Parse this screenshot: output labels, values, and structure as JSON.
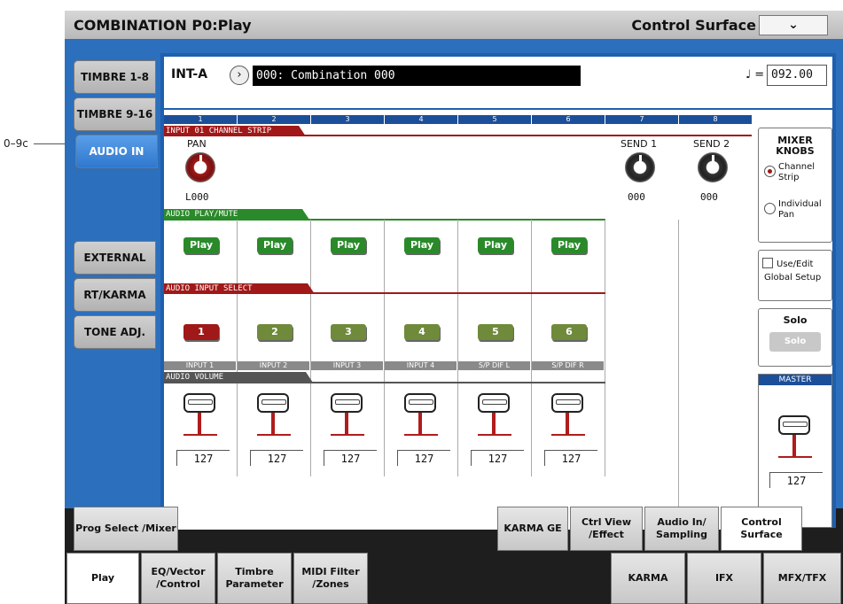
{
  "external_label": "0–9c",
  "title_left": "COMBINATION P0:Play",
  "title_right": "Control Surface",
  "side_tabs": [
    "TIMBRE 1-8",
    "TIMBRE 9-16",
    "AUDIO IN",
    "EXTERNAL",
    "RT/KARMA",
    "TONE ADJ."
  ],
  "bank": "INT-A",
  "program_name": "000: Combination 000",
  "tempo_symbol": "♩ =",
  "tempo": "092.00",
  "channels": [
    "1",
    "2",
    "3",
    "4",
    "5",
    "6",
    "7",
    "8"
  ],
  "sections": {
    "channel_strip": "INPUT 01 CHANNEL STRIP",
    "play_mute": "AUDIO PLAY/MUTE",
    "input_select": "AUDIO INPUT SELECT",
    "volume": "AUDIO VOLUME"
  },
  "pan": {
    "label": "PAN",
    "value": "L000"
  },
  "send1": {
    "label": "SEND 1",
    "value": "000"
  },
  "send2": {
    "label": "SEND 2",
    "value": "000"
  },
  "play_labels": [
    "Play",
    "Play",
    "Play",
    "Play",
    "Play",
    "Play"
  ],
  "input_buttons": [
    "1",
    "2",
    "3",
    "4",
    "5",
    "6"
  ],
  "input_labels": [
    "INPUT 1",
    "INPUT 2",
    "INPUT 3",
    "INPUT 4",
    "S/P DIF L",
    "S/P DIF R"
  ],
  "volumes": [
    "127",
    "127",
    "127",
    "127",
    "127",
    "127"
  ],
  "mixer_knobs": {
    "title": "MIXER KNOBS",
    "opt1": "Channel Strip",
    "opt2": "Individual Pan",
    "selected": "Channel Strip"
  },
  "global_setup": "Use/Edit Global Setup",
  "solo": {
    "title": "Solo",
    "button": "Solo"
  },
  "master": {
    "label": "MASTER",
    "value": "127"
  },
  "page_tabs": [
    "Prog Select /Mixer",
    "KARMA GE",
    "Ctrl View /Effect",
    "Audio In/ Sampling",
    "Control Surface"
  ],
  "mode_tabs": [
    "Play",
    "EQ/Vector /Control",
    "Timbre Parameter",
    "MIDI Filter /Zones",
    "KARMA",
    "IFX",
    "MFX/TFX"
  ],
  "colors": {
    "accent": "#2c6fbd",
    "red": "#a01818",
    "green": "#2a8a2a"
  }
}
